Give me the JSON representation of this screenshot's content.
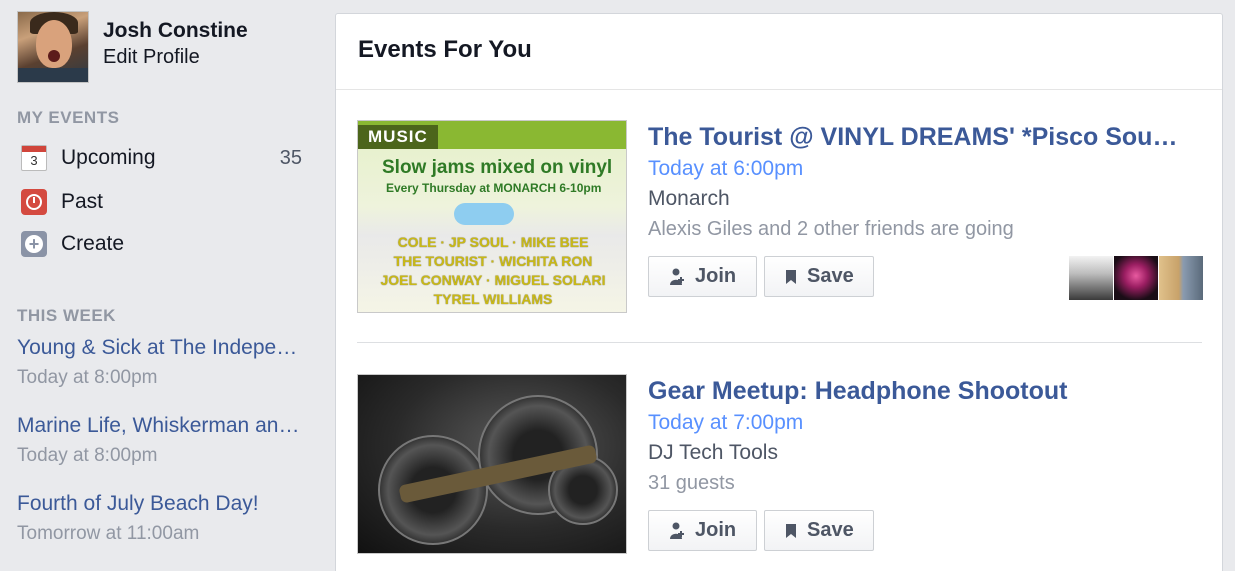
{
  "profile": {
    "name": "Josh Constine",
    "edit_label": "Edit Profile"
  },
  "my_events": {
    "title": "MY EVENTS",
    "items": [
      {
        "label": "Upcoming",
        "count": "35",
        "icon": "calendar-icon"
      },
      {
        "label": "Past",
        "count": "",
        "icon": "clock-icon"
      },
      {
        "label": "Create",
        "count": "",
        "icon": "plus-icon"
      }
    ],
    "calendar_day": "3"
  },
  "this_week": {
    "title": "THIS WEEK",
    "items": [
      {
        "title": "Young & Sick at The Independent",
        "time": "Today at 8:00pm"
      },
      {
        "title": "Marine Life, Whiskerman and more",
        "time": "Today at 8:00pm"
      },
      {
        "title": "Fourth of July Beach Day!",
        "time": "Tomorrow at 11:00am"
      }
    ]
  },
  "main": {
    "title": "Events For You",
    "events": [
      {
        "category": "MUSIC",
        "title": "The Tourist @ VINYL DREAMS' *Pisco Sour Party*",
        "time": "Today at 6:00pm",
        "venue": "Monarch",
        "social": "Alexis Giles and 2 other friends are going",
        "join_label": "Join",
        "save_label": "Save",
        "poster": {
          "headline": "Slow jams mixed on vinyl",
          "subline": "Every Thursday at MONARCH 6-10pm",
          "names": [
            "COLE · JP SOUL · MIKE BEE",
            "THE TOURIST · WICHITA RON",
            "JOEL CONWAY · MIGUEL SOLARI",
            "TYREL WILLIAMS"
          ]
        }
      },
      {
        "title": "Gear Meetup: Headphone Shootout",
        "time": "Today at 7:00pm",
        "venue": "DJ Tech Tools",
        "social": "31 guests",
        "join_label": "Join",
        "save_label": "Save"
      }
    ]
  },
  "colors": {
    "link": "#3b5998",
    "time": "#5890ff",
    "muted": "#9197a3",
    "background": "#e9eaed"
  }
}
